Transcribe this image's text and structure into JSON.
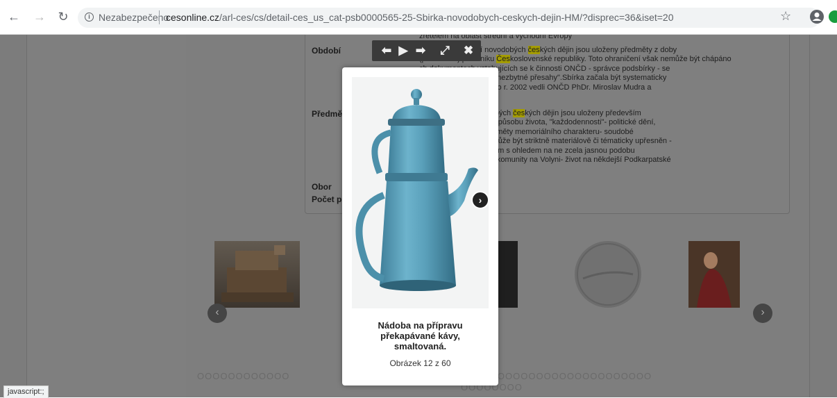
{
  "browser": {
    "security_text": "Nezabezpečeno",
    "url_domain": "cesonline.cz",
    "url_path": "/arl-ces/cs/detail-ces_us_cat-psb0000565-25-Sbirka-novodobych-ceskych-dejin-HM/?disprec=36&iset=20",
    "status_url": "javascript:;"
  },
  "detail": {
    "top_line": "zřetelem na oblast střední a východní Evropy",
    "labels": {
      "period": "Období",
      "subject": "Předmě",
      "field": "Obor",
      "count": "Počet p"
    },
    "period_lines": [
      [
        "",
        "ná-sbírka oddělení novodobých ",
        "čes",
        "kých dějin jsou uloženy předměty z doby"
      ],
      [
        "(především) po vzniku ",
        "",
        "Čes",
        "koslovenské republiky. Toto ohraničení však nemůže být chápáno"
      ],
      [
        "",
        "ch dokumentech vztahujících se k činnosti ONČD - správce podsbírky - se",
        "",
        ""
      ],
      [
        "",
        " tato časová perioda o \"nezbytné přesahy\".Sbírka začala být systematicky",
        "",
        ""
      ],
      [
        "",
        "e 1977.Od roku 1977 do r. 2002 vedli ONČD PhDr. Miroslav Mudra a",
        "",
        ""
      ],
      [
        "",
        "k",
        "",
        ""
      ]
    ],
    "subject_lines": [
      [
        "",
        "bírka oddělení novodobých ",
        "čes",
        "kých dějin jsou uloženy především"
      ],
      [
        "",
        "jící:- podobu a změny způsobu života, \"každodennosti\"- politické dění,",
        "",
        ""
      ],
      [
        "",
        "litickým životem a předměty memoriálního charakteru- soudobé",
        "",
        ""
      ],
      [
        "",
        "ké dění, kdy výběr nemůže být striktně materiálově či tématicky upřesněn -",
        "",
        ""
      ],
      [
        "",
        " výše uvedeným tématům s ohledem na ne zcela jasnou podobu",
        "",
        ""
      ],
      [
        "",
        "muzei- život krajanské komunity na Volyni- život na někdejší Podkarpatské",
        "",
        ""
      ]
    ]
  },
  "lightbox": {
    "title": "Nádoba na přípravu překapávané kávy, smaltovaná.",
    "counter": "Obrázek 12 z 60",
    "toolbar": {
      "prev": "⬅",
      "play": "▶",
      "next": "➡",
      "fullscreen": "⤢",
      "close": "✖"
    }
  },
  "pager": {
    "dots_row1": "OOOOOOOOOOOO",
    "dots_row1b": "OOOOOOOOOOOOOOOOOOOOOOOOO",
    "dots_row2": "OOOOOOOO"
  },
  "colors": {
    "overlay": "#7c7c7c",
    "highlight": "#a49c00",
    "teal_pot": "#5a9fb8"
  }
}
